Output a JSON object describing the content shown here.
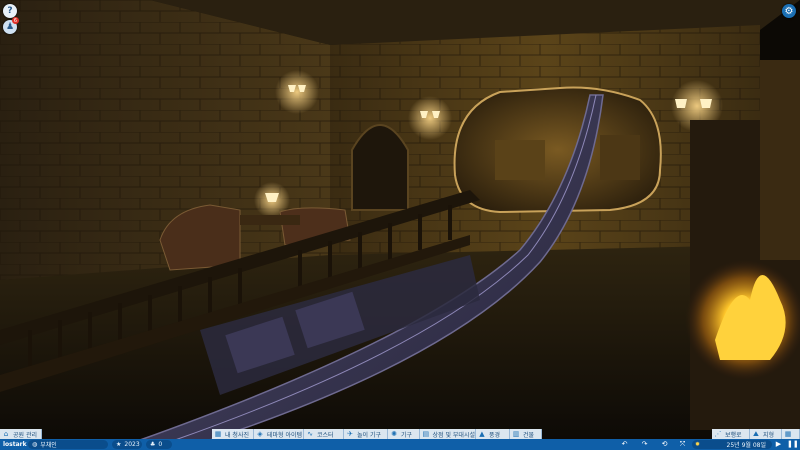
{
  "hud": {
    "help_icon": "?",
    "notification_count": "6",
    "settings_icon": "⚙"
  },
  "menu": {
    "left_tab": {
      "label": "공원 관리",
      "icon": "park-icon"
    },
    "center_tabs": [
      {
        "label": "내 청사진",
        "icon": "blueprint-icon"
      },
      {
        "label": "테마형 아이템",
        "icon": "scenery-icon"
      },
      {
        "label": "코스터",
        "icon": "coaster-icon"
      },
      {
        "label": "놀이 기구",
        "icon": "ride-icon"
      },
      {
        "label": "기구",
        "icon": "flatride-icon"
      },
      {
        "label": "상점 및 부대시설",
        "icon": "shop-icon"
      },
      {
        "label": "풍경",
        "icon": "terrain-icon"
      },
      {
        "label": "건물",
        "icon": "building-icon"
      }
    ],
    "right_tabs": [
      {
        "label": "보행로",
        "icon": "path-icon"
      },
      {
        "label": "지형",
        "icon": "landscape-icon"
      }
    ]
  },
  "status": {
    "park_name": "lostark",
    "loan": "부채인",
    "rating": "2023",
    "guests": "0",
    "date": "25년 9월 08일"
  },
  "colors": {
    "bar_blue": "#0f5fa8",
    "tab_bg": "#e4eff9",
    "fire": "#ffcc33",
    "lamp": "#ffd98a"
  }
}
